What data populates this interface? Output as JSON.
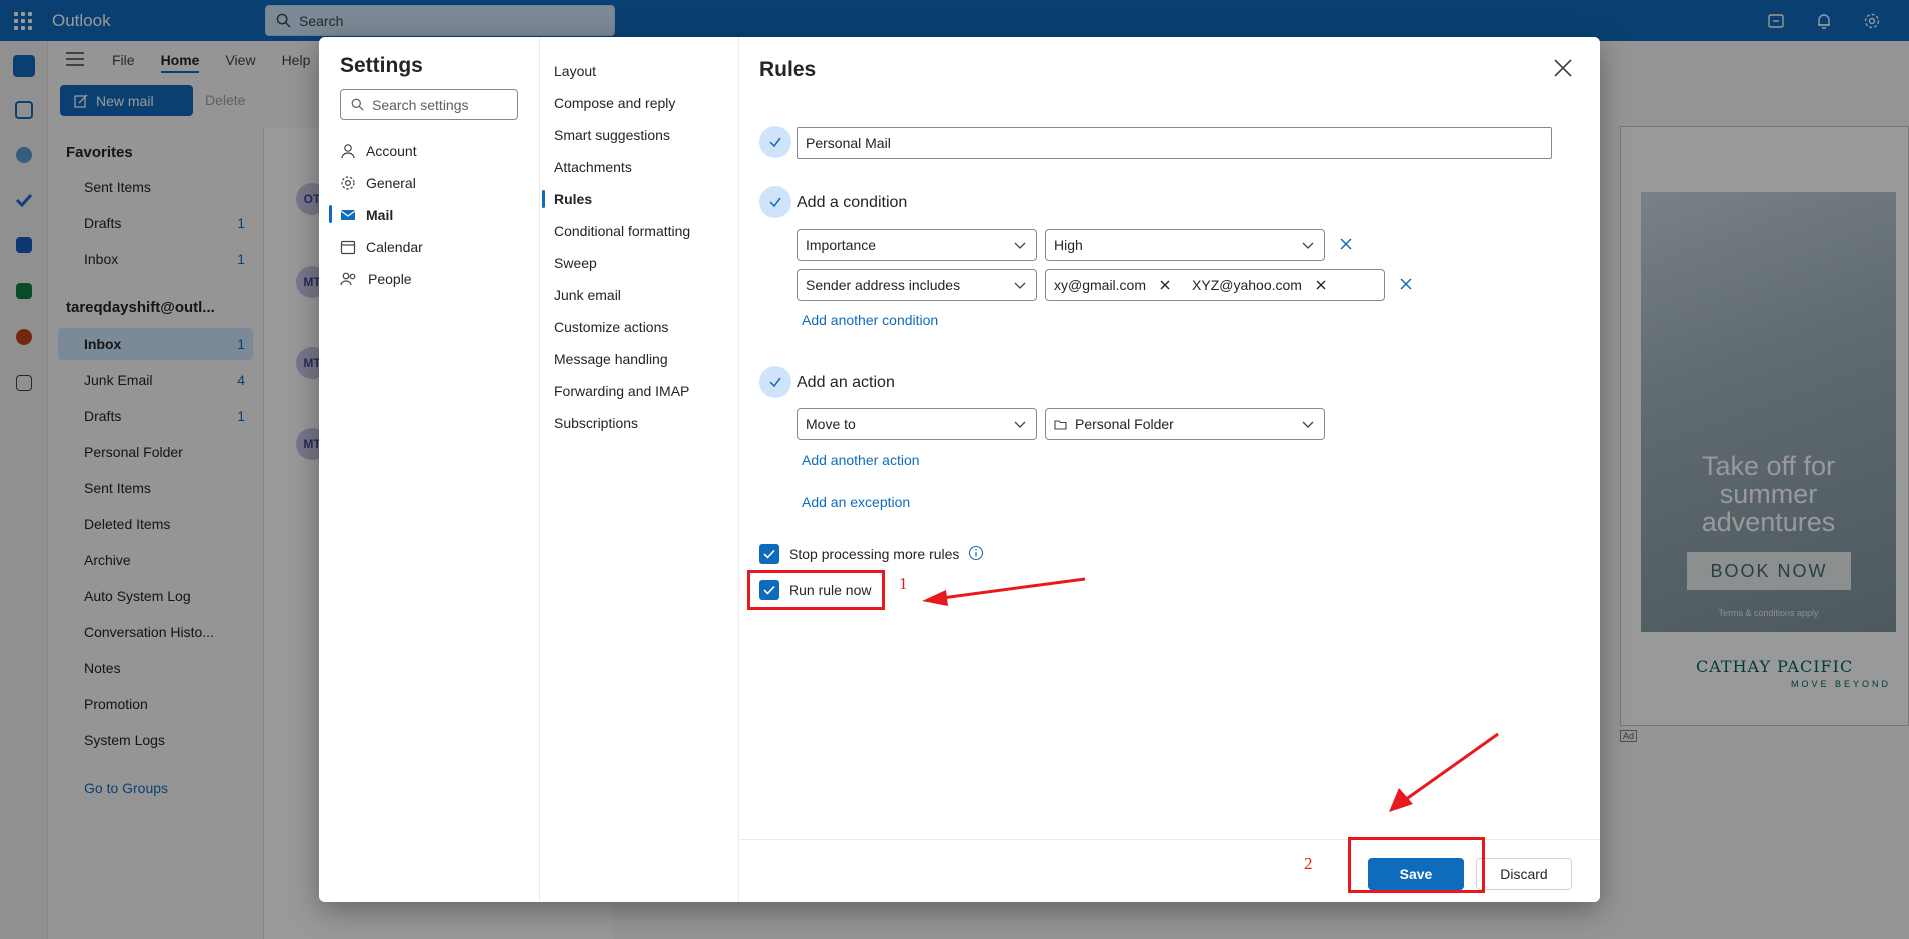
{
  "app": {
    "title": "Outlook",
    "search_placeholder": "Search"
  },
  "top_icons": [
    "my-day-icon",
    "bell-icon",
    "gear-icon"
  ],
  "ribbon": {
    "tabs": [
      "File",
      "Home",
      "View",
      "Help"
    ],
    "active_tab": "Home",
    "new_mail": "New mail",
    "delete": "Delete"
  },
  "nav": {
    "favorites_header": "Favorites",
    "favorites": [
      {
        "label": "Sent Items",
        "count": ""
      },
      {
        "label": "Drafts",
        "count": "1"
      },
      {
        "label": "Inbox",
        "count": "1"
      }
    ],
    "account_header": "tareqdayshift@outl...",
    "folders": [
      {
        "label": "Inbox",
        "count": "1"
      },
      {
        "label": "Junk Email",
        "count": "4"
      },
      {
        "label": "Drafts",
        "count": "1"
      },
      {
        "label": "Personal Folder",
        "count": ""
      },
      {
        "label": "Sent Items",
        "count": ""
      },
      {
        "label": "Deleted Items",
        "count": ""
      },
      {
        "label": "Archive",
        "count": ""
      },
      {
        "label": "Auto System Log",
        "count": ""
      },
      {
        "label": "Conversation Histo...",
        "count": ""
      },
      {
        "label": "Notes",
        "count": ""
      },
      {
        "label": "Promotion",
        "count": ""
      },
      {
        "label": "System Logs",
        "count": ""
      }
    ],
    "go_to_groups": "Go to Groups"
  },
  "message_avatars": [
    "OT",
    "MT",
    "MT",
    "MT"
  ],
  "ad": {
    "headline_lines": [
      "Take off for",
      "summer",
      "adventures"
    ],
    "cta": "BOOK NOW",
    "terms": "Terms & conditions apply",
    "brand": "CATHAY PACIFIC",
    "tagline": "MOVE BEYOND",
    "ad_label": "Ad"
  },
  "settings": {
    "title": "Settings",
    "search_placeholder": "Search settings",
    "categories": [
      "Account",
      "General",
      "Mail",
      "Calendar",
      "People"
    ],
    "selected_category": "Mail",
    "subcategories": [
      "Layout",
      "Compose and reply",
      "Smart suggestions",
      "Attachments",
      "Rules",
      "Conditional formatting",
      "Sweep",
      "Junk email",
      "Customize actions",
      "Message handling",
      "Forwarding and IMAP",
      "Subscriptions"
    ],
    "selected_subcategory": "Rules"
  },
  "rules": {
    "title": "Rules",
    "rule_name": "Personal Mail",
    "condition_header": "Add a condition",
    "condition1": {
      "field": "Importance",
      "value": "High"
    },
    "condition2": {
      "field": "Sender address includes",
      "values": [
        "xy@gmail.com",
        "XYZ@yahoo.com"
      ]
    },
    "add_condition": "Add another condition",
    "action_header": "Add an action",
    "action": {
      "field": "Move to",
      "value": "Personal Folder"
    },
    "add_action": "Add another action",
    "add_exception": "Add an exception",
    "stop_processing": "Stop processing more rules",
    "run_rule_now": "Run rule now",
    "save": "Save",
    "discard": "Discard"
  },
  "annotations": {
    "label1": "1",
    "label2": "2",
    "color": "#e8191d"
  },
  "colors": {
    "brand": "#0f6cbd",
    "selection": "#cfe4fa"
  }
}
